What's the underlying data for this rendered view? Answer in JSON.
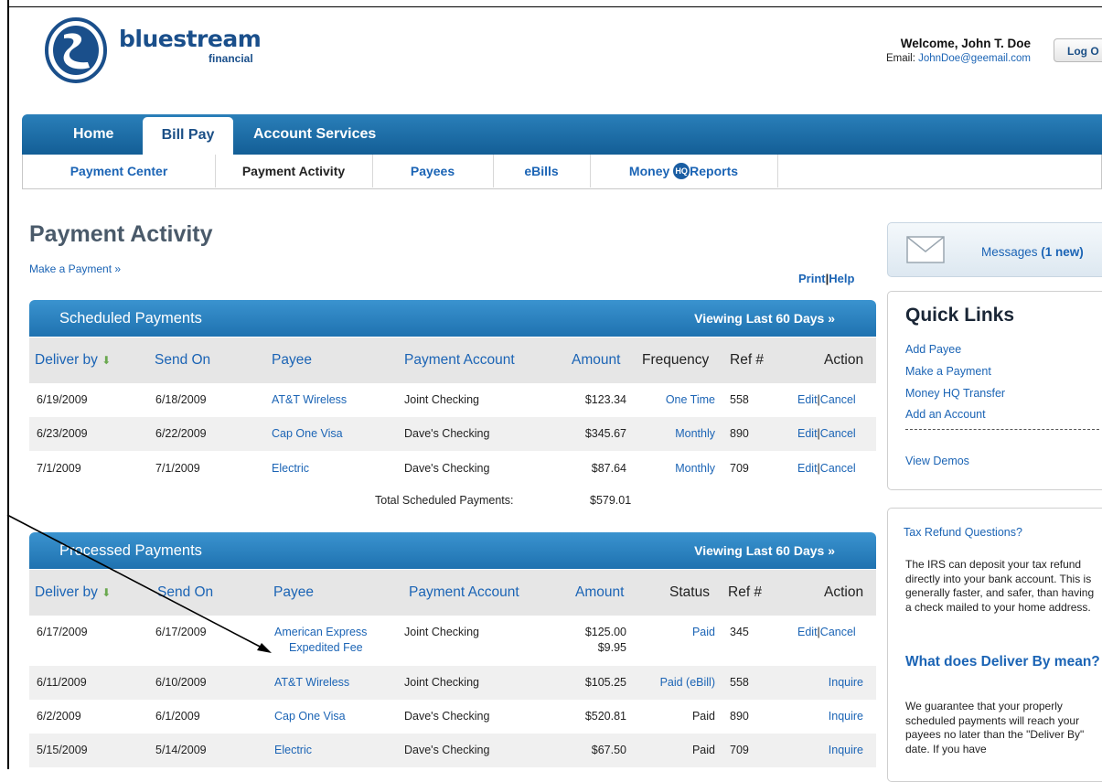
{
  "header": {
    "brand": "bluestream",
    "brand_sub": "financial",
    "welcome": "Welcome, John T. Doe",
    "email_label": "Email:",
    "email": "JohnDoe@geemail.com",
    "logout_label": "Log O"
  },
  "nav": {
    "tabs": [
      {
        "label": "Home"
      },
      {
        "label": "Bill Pay"
      },
      {
        "label": "Account Services"
      }
    ],
    "subnav": [
      {
        "label": "Payment Center"
      },
      {
        "label": "Payment Activity"
      },
      {
        "label": "Payees"
      },
      {
        "label": "eBills"
      },
      {
        "label_pre": "Money ",
        "hq": "HQ",
        "label_post": "Reports"
      }
    ]
  },
  "page": {
    "title": "Payment Activity",
    "make_payment": "Make a Payment »",
    "print": "Print",
    "help": "Help"
  },
  "scheduled": {
    "title": "Scheduled Payments",
    "viewing": "Viewing Last 60 Days »",
    "columns": {
      "deliver": "Deliver by",
      "send": "Send On",
      "payee": "Payee",
      "account": "Payment Account",
      "amount": "Amount",
      "frequency": "Frequency",
      "ref": "Ref #",
      "action": "Action"
    },
    "rows": [
      {
        "deliver": "6/19/2009",
        "send": "6/18/2009",
        "payee": "AT&T Wireless",
        "account": "Joint Checking",
        "amount": "$123.34",
        "frequency": "One Time",
        "ref": "558",
        "edit": "Edit",
        "cancel": "Cancel"
      },
      {
        "deliver": "6/23/2009",
        "send": "6/22/2009",
        "payee": "Cap One Visa",
        "account": "Dave's Checking",
        "amount": "$345.67",
        "frequency": "Monthly",
        "ref": "890",
        "edit": "Edit",
        "cancel": "Cancel"
      },
      {
        "deliver": "7/1/2009",
        "send": "7/1/2009",
        "payee": "Electric",
        "account": "Dave's Checking",
        "amount": "$87.64",
        "frequency": "Monthly",
        "ref": "709",
        "edit": "Edit",
        "cancel": "Cancel"
      }
    ],
    "total_label": "Total Scheduled Payments:",
    "total_value": "$579.01"
  },
  "processed": {
    "title": "Processed Payments",
    "viewing": "Viewing Last 60 Days »",
    "columns": {
      "deliver": "Deliver by",
      "send": "Send On",
      "payee": "Payee",
      "account": "Payment Account",
      "amount": "Amount",
      "status": "Status",
      "ref": "Ref #",
      "action": "Action"
    },
    "rows": [
      {
        "deliver": "6/17/2009",
        "send": "6/17/2009",
        "payee": "American Express",
        "payee2": "Expedited Fee",
        "account": "Joint Checking",
        "amount": "$125.00",
        "amount2": "$9.95",
        "status": "Paid",
        "ref": "345",
        "edit": "Edit",
        "cancel": "Cancel"
      },
      {
        "deliver": "6/11/2009",
        "send": "6/10/2009",
        "payee": "AT&T Wireless",
        "account": "Joint Checking",
        "amount": "$105.25",
        "status": "Paid (eBill)",
        "ref": "558",
        "inquire": "Inquire"
      },
      {
        "deliver": "6/2/2009",
        "send": "6/1/2009",
        "payee": "Cap One Visa",
        "account": "Dave's Checking",
        "amount": "$520.81",
        "status": "Paid",
        "ref": "890",
        "inquire": "Inquire"
      },
      {
        "deliver": "5/15/2009",
        "send": "5/14/2009",
        "payee": "Electric",
        "account": "Dave's Checking",
        "amount": "$67.50",
        "status": "Paid",
        "ref": "709",
        "inquire": "Inquire"
      }
    ]
  },
  "sidebar": {
    "messages_label": "Messages",
    "messages_count": "(1 new)",
    "quick_links_title": "Quick Links",
    "quick_links": [
      "Add Payee",
      "Make a Payment",
      "Money HQ Transfer",
      "Add an Account"
    ],
    "view_demos": "View Demos",
    "tax_title": "Tax Refund Questions?",
    "tax_body": "The IRS can deposit your tax refund directly into your bank account. This is generally faster, and safer, than having a check mailed to your home address.",
    "deliver_title": "What does Deliver By mean?",
    "deliver_body": "We guarantee that your properly scheduled payments will reach your payees no later than the \"Deliver By\" date. If you have"
  }
}
